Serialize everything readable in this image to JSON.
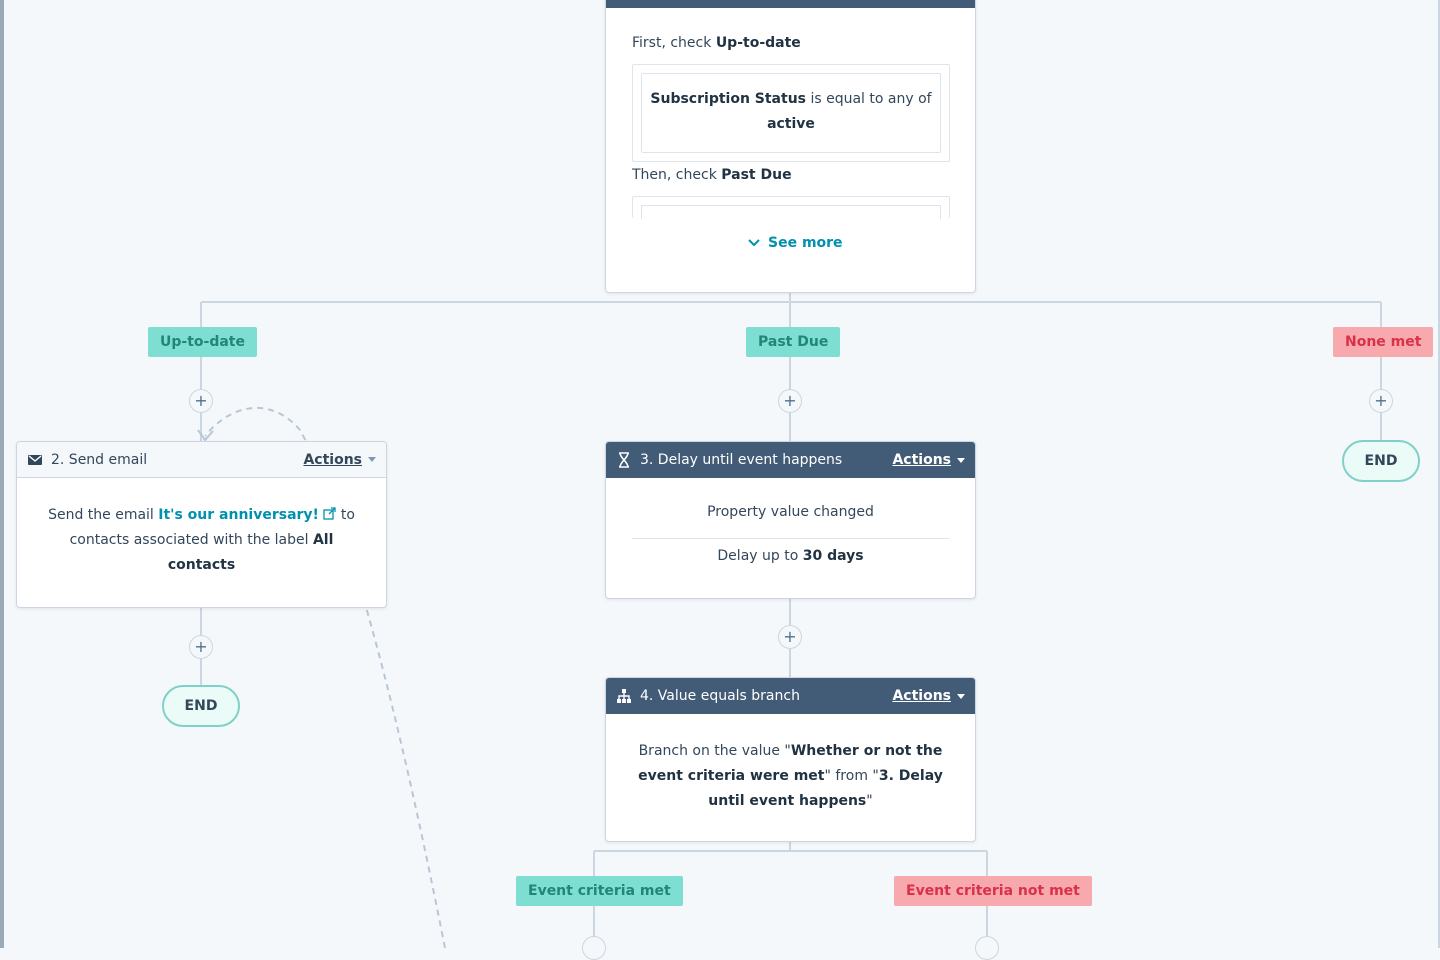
{
  "top_card": {
    "first_check_prefix": "First, check",
    "first_check_branch": "Up-to-date",
    "condition_property": "Subscription Status",
    "condition_operator": "is equal to any of",
    "condition_value": "active",
    "then_check_prefix": "Then, check",
    "then_check_branch": "Past Due",
    "see_more_label": "See more"
  },
  "branches": {
    "up_to_date": "Up-to-date",
    "past_due": "Past Due",
    "none_met": "None met",
    "event_met": "Event criteria met",
    "event_not_met": "Event criteria not met"
  },
  "plus_symbol": "+",
  "end_label": "END",
  "actions_label": "Actions",
  "email_card": {
    "title": "2. Send email",
    "text_1": "Send the email",
    "email_name": "It's our anniversary!",
    "text_2": "to",
    "text_3": "contacts associated with the label",
    "label_name": "All contacts"
  },
  "delay_card": {
    "title": "3. Delay until event happens",
    "line_1": "Property value changed",
    "delay_prefix": "Delay up to",
    "delay_value": "30 days"
  },
  "branch_card": {
    "title": "4. Value equals branch",
    "text_1": "Branch on the value \"",
    "value_name": "Whether or not the event criteria were met",
    "text_2": "\" from \"",
    "source_name": "3. Delay until event happens",
    "text_3": "\""
  },
  "colors": {
    "dark_header": "#425b76",
    "link": "#0091ae",
    "green_label_bg": "#7fded2",
    "green_label_text": "#20867a",
    "red_label_bg": "#f8a9ad",
    "red_label_text": "#d9314a"
  }
}
